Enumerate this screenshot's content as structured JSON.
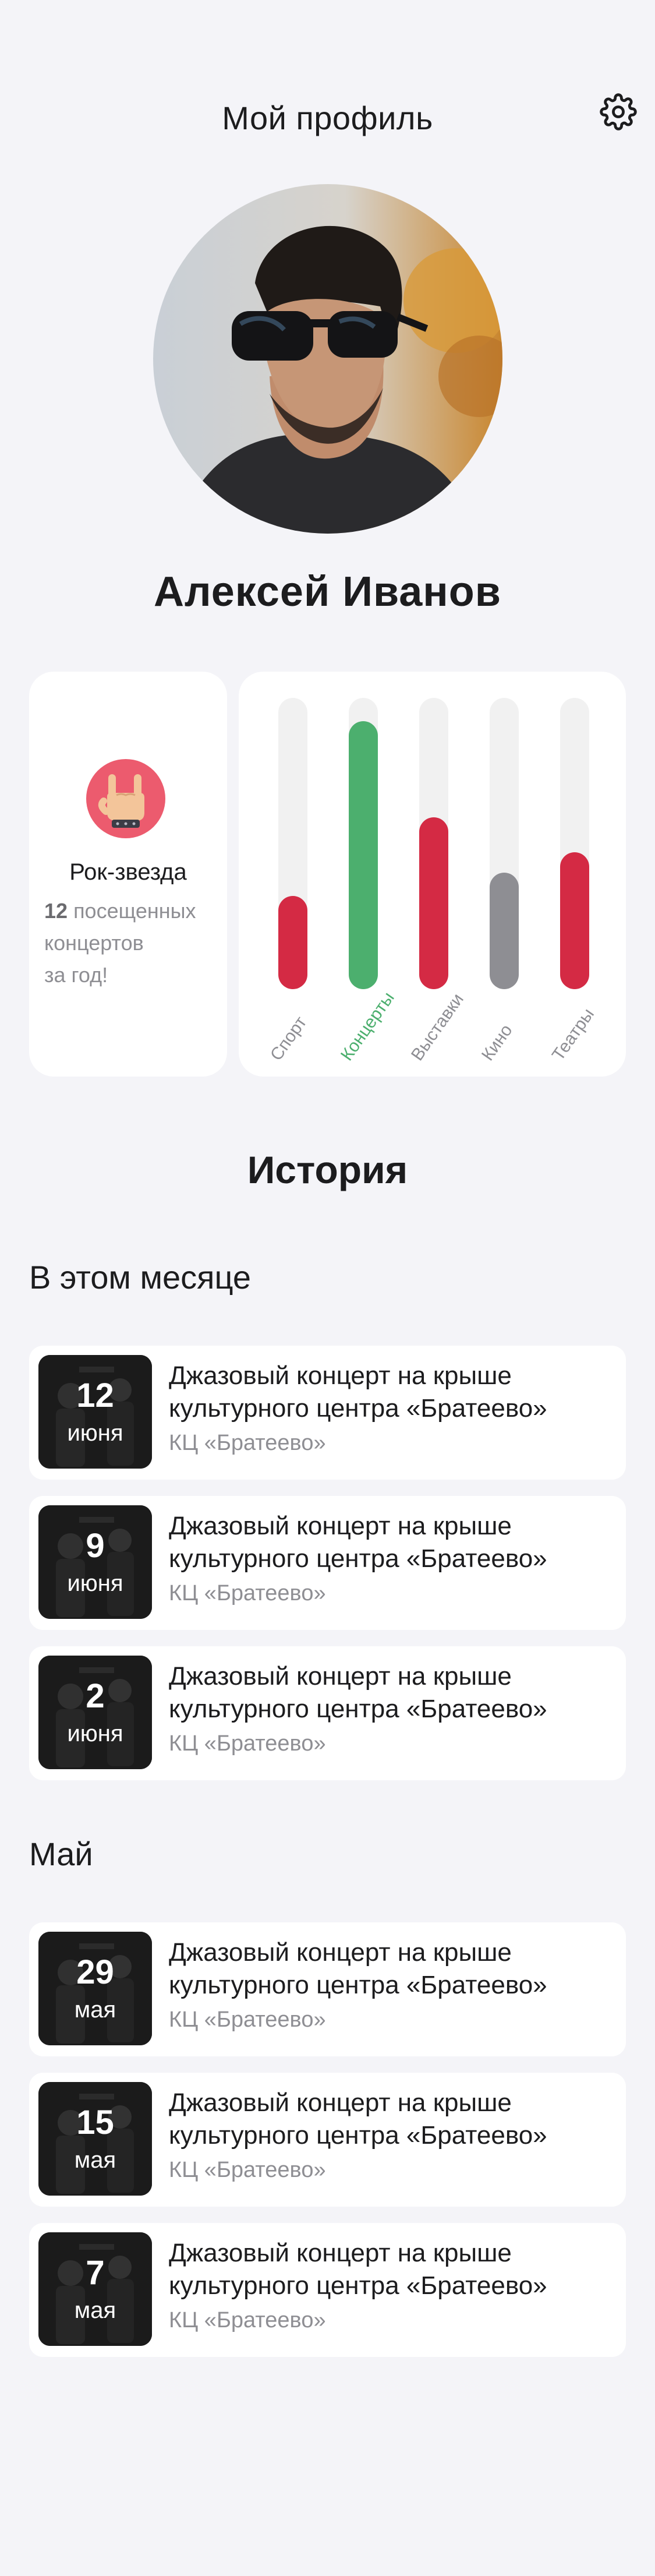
{
  "header": {
    "title": "Мой профиль",
    "settings_icon": "gear-icon"
  },
  "profile": {
    "name": "Алексей Иванов"
  },
  "badge": {
    "icon": "rock-hand-icon",
    "title": "Рок-звезда",
    "count": "12",
    "text_line1": "посещенных",
    "text_line2": "концертов",
    "text_line3": "за год!"
  },
  "chart_data": {
    "type": "bar",
    "categories": [
      "Спорт",
      "Концерты",
      "Выставки",
      "Кино",
      "Театры"
    ],
    "values": [
      32,
      92,
      59,
      40,
      47
    ],
    "ylim": [
      0,
      100
    ],
    "colors": [
      "#d42a44",
      "#4caf6e",
      "#d42a44",
      "#8e8e93",
      "#d42a44"
    ],
    "highlight_label_color": "#4caf6e",
    "grid": false
  },
  "history": {
    "title": "История",
    "sections": [
      {
        "title": "В этом месяце",
        "events": [
          {
            "day": "12",
            "month": "июня",
            "title": "Джазовый концерт на крыше культурного центра «Братеево»",
            "venue": "КЦ «Братеево»"
          },
          {
            "day": "9",
            "month": "июня",
            "title": "Джазовый концерт на крыше культурного центра «Братеево»",
            "venue": "КЦ «Братеево»"
          },
          {
            "day": "2",
            "month": "июня",
            "title": "Джазовый концерт на крыше культурного центра «Братеево»",
            "venue": "КЦ «Братеево»"
          }
        ]
      },
      {
        "title": "Май",
        "events": [
          {
            "day": "29",
            "month": "мая",
            "title": "Джазовый концерт на крыше культурного центра «Братеево»",
            "venue": "КЦ «Братеево»"
          },
          {
            "day": "15",
            "month": "мая",
            "title": "Джазовый концерт на крыше культурного центра «Братеево»",
            "venue": "КЦ «Братеево»"
          },
          {
            "day": "7",
            "month": "мая",
            "title": "Джазовый концерт на крыше культурного центра «Братеево»",
            "venue": "КЦ «Братеево»"
          }
        ]
      }
    ]
  }
}
